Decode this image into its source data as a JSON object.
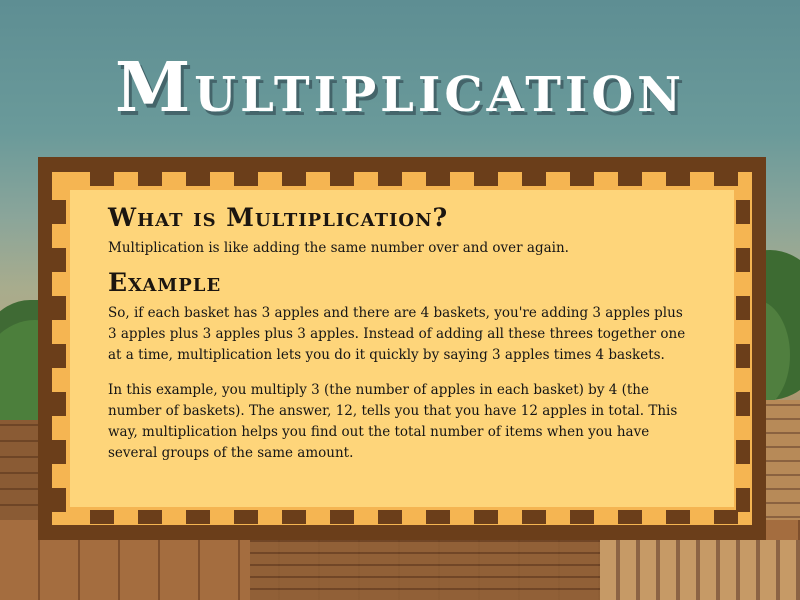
{
  "title": "Multiplication",
  "section_what": {
    "heading": "What is Multiplication?",
    "text": "Multiplication is like adding the same number over and over again."
  },
  "section_example": {
    "heading": "Example",
    "paragraph_1": "So, if each basket has 3 apples and there are 4 baskets, you're adding 3 apples plus 3 apples plus 3 apples plus 3 apples. Instead of adding all these threes together one at a time, multiplication lets you do it quickly by saying 3 apples times 4 baskets.",
    "paragraph_2": "In this example, you multiply 3 (the number of apples in each basket) by 4 (the number of baskets). The answer, 12, tells you that you have 12 apples in total. This way, multiplication helps you find out the total number of items when you have several groups of the same amount."
  },
  "colors": {
    "frame_dark": "#6b3e1a",
    "frame_mid": "#f5b552",
    "panel": "#fed57a",
    "title": "#ffffff"
  }
}
